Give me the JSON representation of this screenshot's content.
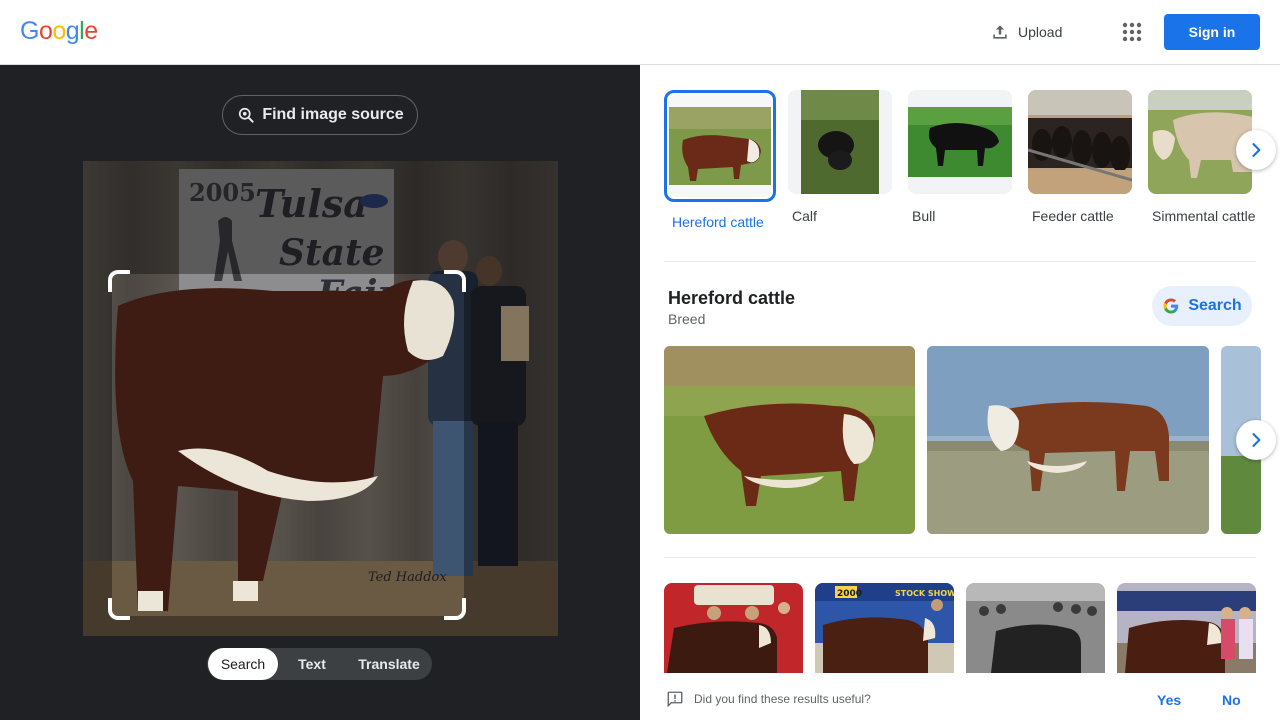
{
  "header": {
    "logo_letters": [
      {
        "ch": "G",
        "color": "#4285F4"
      },
      {
        "ch": "o",
        "color": "#EA4335"
      },
      {
        "ch": "o",
        "color": "#FBBC05"
      },
      {
        "ch": "g",
        "color": "#4285F4"
      },
      {
        "ch": "l",
        "color": "#34A853"
      },
      {
        "ch": "e",
        "color": "#EA4335"
      }
    ],
    "upload_label": "Upload",
    "upload_icon": "upload-icon",
    "apps_icon": "apps-grid-icon",
    "signin_label": "Sign in"
  },
  "query": {
    "find_source_label": "Find image source",
    "find_source_icon": "lens-search-icon",
    "image_text": {
      "year": "2005",
      "line1": "Tulsa",
      "line2": "State",
      "line3": "Fair",
      "signature": "Ted Haddox"
    },
    "modes": [
      {
        "label": "Search",
        "active": true
      },
      {
        "label": "Text",
        "active": false
      },
      {
        "label": "Translate",
        "active": false
      }
    ]
  },
  "related": {
    "chips": [
      {
        "label": "Hereford cattle",
        "selected": true
      },
      {
        "label": "Calf",
        "selected": false
      },
      {
        "label": "Bull",
        "selected": false
      },
      {
        "label": "Feeder cattle",
        "selected": false
      },
      {
        "label": "Simmental cattle",
        "selected": false
      }
    ],
    "next_icon": "chevron-right-icon"
  },
  "knowledge": {
    "title": "Hereford cattle",
    "subtitle": "Breed",
    "search_label": "Search",
    "search_icon": "google-g-icon"
  },
  "matches": {
    "banner_year": "2000",
    "banner_text": "STOCK SHOW"
  },
  "feedback": {
    "question": "Did you find these results useful?",
    "yes_label": "Yes",
    "no_label": "No",
    "icon": "feedback-icon"
  },
  "colors": {
    "accent": "#1a73e8",
    "dark_bg": "#202124"
  }
}
